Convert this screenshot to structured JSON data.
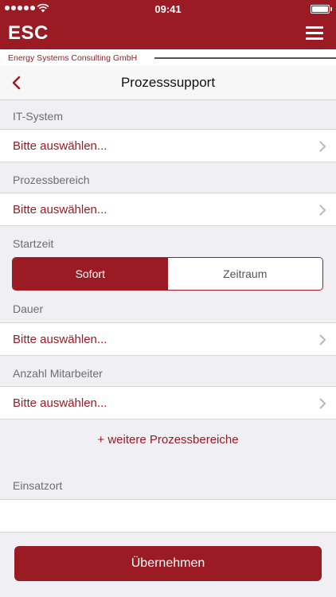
{
  "status_bar": {
    "time": "09:41",
    "signal_icon": "signal-dots-icon",
    "wifi_icon": "wifi-icon",
    "battery_icon": "battery-icon",
    "battery_level": 1.0
  },
  "app_bar": {
    "logo": "ESC",
    "menu_icon": "hamburger-menu-icon"
  },
  "company_bar": {
    "company_name": "Energy Systems Consulting GmbH"
  },
  "nav": {
    "back_icon": "chevron-left-icon",
    "title": "Prozesssupport"
  },
  "form": {
    "it_system": {
      "label": "IT-System",
      "value": "Bitte auswählen..."
    },
    "process_area": {
      "label": "Prozessbereich",
      "value": "Bitte auswählen..."
    },
    "start_time": {
      "label": "Startzeit",
      "options": [
        "Sofort",
        "Zeitraum"
      ],
      "selected": "Sofort"
    },
    "duration": {
      "label": "Dauer",
      "value": "Bitte auswählen..."
    },
    "employee_count": {
      "label": "Anzahl Mitarbeiter",
      "value": "Bitte auswählen..."
    },
    "more_process_areas": "+ weitere Prozessbereiche",
    "location": {
      "label": "Einsatzort",
      "value": "",
      "placeholder": ""
    }
  },
  "submit_button": "Übernehmen",
  "colors": {
    "brand": "#9b1b24",
    "background": "#efeff4",
    "label": "#6d6d72"
  }
}
